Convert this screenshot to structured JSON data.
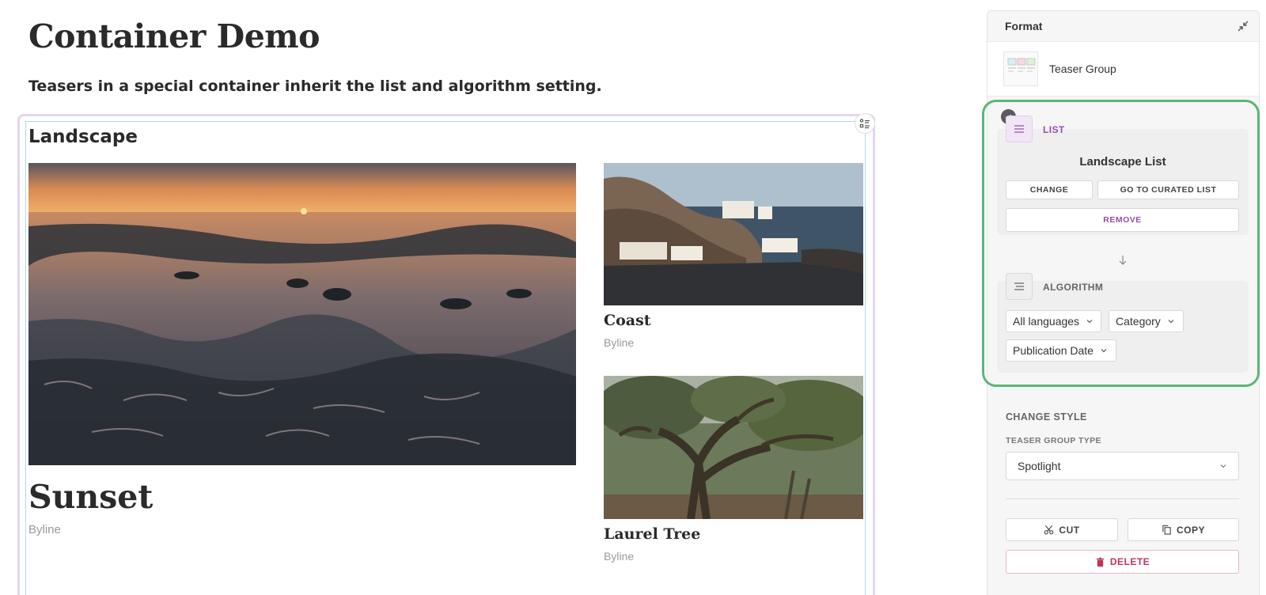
{
  "page": {
    "title": "Container Demo",
    "lead": "Teasers in a special container inherit the list and algorithm setting."
  },
  "container": {
    "section_title": "Landscape",
    "teasers": [
      {
        "title": "Sunset",
        "byline": "Byline"
      },
      {
        "title": "Coast",
        "byline": "Byline"
      },
      {
        "title": "Laurel Tree",
        "byline": "Byline"
      }
    ]
  },
  "panel": {
    "header": "Format",
    "type_label": "Teaser Group",
    "list": {
      "heading": "LIST",
      "name": "Landscape List",
      "change_label": "CHANGE",
      "goto_label": "GO TO CURATED LIST",
      "remove_label": "REMOVE"
    },
    "algorithm": {
      "heading": "ALGORITHM",
      "language": "All languages",
      "category": "Category",
      "sort": "Publication Date"
    },
    "style": {
      "heading": "CHANGE STYLE",
      "type_label": "TEASER GROUP TYPE",
      "type_value": "Spotlight"
    },
    "actions": {
      "cut_label": "CUT",
      "copy_label": "COPY",
      "delete_label": "DELETE"
    }
  },
  "colors": {
    "accent_purple": "#9a4cb3",
    "highlight_green": "#5ab678",
    "delete_red": "#c03557"
  },
  "icons": [
    "list-toggle-icon",
    "collapse-icon",
    "check-icon",
    "list-icon",
    "arrow-down-icon",
    "algorithm-icon",
    "chevron-down-icon",
    "scissors-icon",
    "copy-icon",
    "trash-icon"
  ]
}
